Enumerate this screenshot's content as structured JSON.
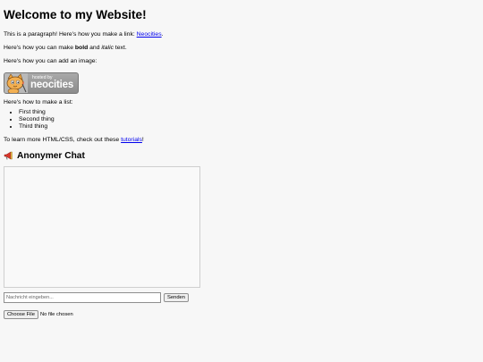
{
  "heading": "Welcome to my Website!",
  "para1": {
    "before": "This is a paragraph! Here's how you make a link: ",
    "link": "Neocities",
    "after": "."
  },
  "para2": {
    "before": "Here's how you can make ",
    "bold": "bold",
    "mid": " and ",
    "italic": "italic",
    "after": " text."
  },
  "para3": "Here's how you can add an image:",
  "badge": {
    "small": "hosted by",
    "big": "neocities"
  },
  "list_intro": "Here's how to make a list:",
  "list_items": [
    "First thing",
    "Second thing",
    "Third thing"
  ],
  "para4": {
    "before": "To learn more HTML/CSS, check out these ",
    "link": "tutorials",
    "after": "!"
  },
  "chat": {
    "title": "Anonymer Chat",
    "icon": "megaphone-icon",
    "message_placeholder": "Nachricht eingeben...",
    "send_label": "Senden",
    "file_button_label": "Choose File",
    "file_status": "No file chosen"
  }
}
